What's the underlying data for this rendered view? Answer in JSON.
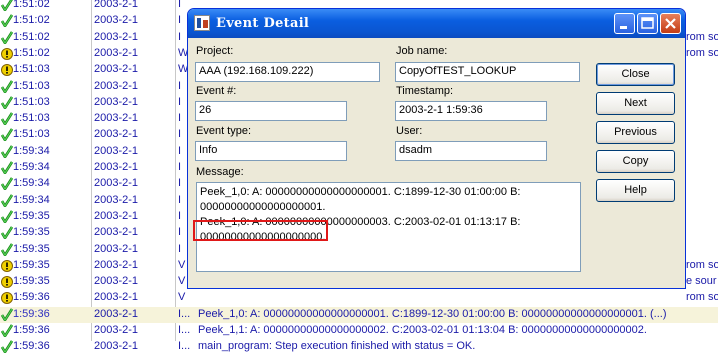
{
  "log": {
    "rows": [
      {
        "status": "ok",
        "time": "1:51:02",
        "date": "2003-2-1",
        "type": "I",
        "msg": ""
      },
      {
        "status": "ok",
        "time": "1:51:02",
        "date": "2003-2-1",
        "type": "I",
        "msg": ""
      },
      {
        "status": "ok",
        "time": "1:51:02",
        "date": "2003-2-1",
        "type": "I",
        "msg": ""
      },
      {
        "status": "warn",
        "time": "1:51:02",
        "date": "2003-2-1",
        "type": "W",
        "msg": ""
      },
      {
        "status": "warn",
        "time": "1:51:03",
        "date": "2003-2-1",
        "type": "W",
        "msg": ""
      },
      {
        "status": "ok",
        "time": "1:51:03",
        "date": "2003-2-1",
        "type": "I",
        "msg": ""
      },
      {
        "status": "ok",
        "time": "1:51:03",
        "date": "2003-2-1",
        "type": "I",
        "msg": ""
      },
      {
        "status": "ok",
        "time": "1:51:03",
        "date": "2003-2-1",
        "type": "I",
        "msg": ""
      },
      {
        "status": "ok",
        "time": "1:51:03",
        "date": "2003-2-1",
        "type": "I",
        "msg": ""
      },
      {
        "status": "ok",
        "time": "1:59:34",
        "date": "2003-2-1",
        "type": "I",
        "msg": ""
      },
      {
        "status": "ok",
        "time": "1:59:34",
        "date": "2003-2-1",
        "type": "I",
        "msg": ""
      },
      {
        "status": "ok",
        "time": "1:59:34",
        "date": "2003-2-1",
        "type": "I",
        "msg": ""
      },
      {
        "status": "ok",
        "time": "1:59:34",
        "date": "2003-2-1",
        "type": "I",
        "msg": ""
      },
      {
        "status": "ok",
        "time": "1:59:35",
        "date": "2003-2-1",
        "type": "I",
        "msg": ""
      },
      {
        "status": "ok",
        "time": "1:59:35",
        "date": "2003-2-1",
        "type": "I",
        "msg": ""
      },
      {
        "status": "ok",
        "time": "1:59:35",
        "date": "2003-2-1",
        "type": "I",
        "msg": ""
      },
      {
        "status": "warn",
        "time": "1:59:35",
        "date": "2003-2-1",
        "type": "V",
        "msg": ""
      },
      {
        "status": "warn",
        "time": "1:59:35",
        "date": "2003-2-1",
        "type": "V",
        "msg": ""
      },
      {
        "status": "warn",
        "time": "1:59:36",
        "date": "2003-2-1",
        "type": "V",
        "msg": ""
      },
      {
        "status": "ok",
        "time": "1:59:36",
        "date": "2003-2-1",
        "type": "I...",
        "msg": "Peek_1,0: A: 00000000000000000001. C:1899-12-30 01:00:00 B: 00000000000000000001. (...)",
        "hl": true
      },
      {
        "status": "ok",
        "time": "1:59:36",
        "date": "2003-2-1",
        "type": "I...",
        "msg": "Peek_1,1: A: 00000000000000000002. C:2003-02-01 01:13:04 B: 00000000000000000002."
      },
      {
        "status": "ok",
        "time": "1:59:36",
        "date": "2003-2-1",
        "type": "I...",
        "msg": "main_program: Step execution finished with status = OK."
      }
    ],
    "edge_texts": [
      {
        "row": 2,
        "text": "rom so"
      },
      {
        "row": 3,
        "text": "rom so"
      },
      {
        "row": 16,
        "text": "rom so"
      },
      {
        "row": 17,
        "text": "e sour"
      },
      {
        "row": 18,
        "text": "rom so"
      }
    ]
  },
  "dialog": {
    "title": "Event Detail",
    "labels": {
      "project": "Project:",
      "job_name": "Job name:",
      "event_num": "Event #:",
      "timestamp": "Timestamp:",
      "event_type": "Event type:",
      "user": "User:",
      "message": "Message:"
    },
    "fields": {
      "project": "AAA (192.168.109.222)",
      "job_name": "CopyOfTEST_LOOKUP",
      "event_num": "26",
      "timestamp": "2003-2-1 1:59:36",
      "event_type": "Info",
      "user": "dsadm"
    },
    "message_lines": [
      "Peek_1,0: A: 00000000000000000001. C:1899-12-30 01:00:00 B:",
      "00000000000000000001.",
      "Peek_1,0: A: 00000000000000000003. C:2003-02-01 01:13:17 B:",
      "00000000000000000000."
    ],
    "buttons": {
      "close": "Close",
      "next": "Next",
      "previous": "Previous",
      "copy": "Copy",
      "help": "Help"
    },
    "colors": {
      "titlebar": "#0a5ee0",
      "highlight_box": "#e01818"
    }
  }
}
